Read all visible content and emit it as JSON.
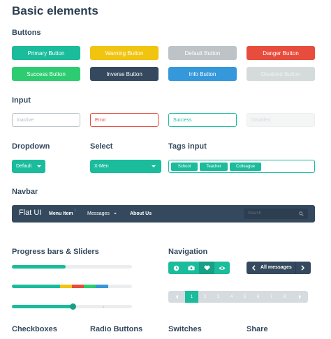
{
  "page_title": "Basic elements",
  "sections": {
    "buttons": "Buttons",
    "input": "Input",
    "dropdown": "Dropdown",
    "select": "Select",
    "tags_input": "Tags input",
    "navbar": "Navbar",
    "progress": "Progress bars & Sliders",
    "navigation": "Navigation",
    "checkboxes": "Checkboxes",
    "radio_buttons": "Radio Buttons",
    "switches": "Switches",
    "share": "Share"
  },
  "buttons": {
    "primary": "Primary Button",
    "warning": "Warning Button",
    "default": "Default Button",
    "danger": "Danger Button",
    "success": "Success Button",
    "inverse": "Inverse Button",
    "info": "Info Button",
    "disabled": "Disabled Button"
  },
  "inputs": {
    "inactive_placeholder": "Inactive",
    "error_placeholder": "Error",
    "success_placeholder": "Success",
    "disabled_placeholder": "Disabled"
  },
  "dropdown": {
    "label": "Default"
  },
  "select": {
    "selected": "X-Men"
  },
  "tags": [
    "School",
    "Teacher",
    "Colleague"
  ],
  "navbar": {
    "brand": "Flat UI",
    "menu_item": "Menu Item",
    "menu_item_badge": "1",
    "messages": "Messages",
    "about": "About Us",
    "search_placeholder": "Search"
  },
  "progress": {
    "bar1_percent": 45,
    "bar2_segments": [
      {
        "color": "#1abc9c",
        "percent": 40
      },
      {
        "color": "#f1c40f",
        "percent": 10
      },
      {
        "color": "#e74c3c",
        "percent": 10
      },
      {
        "color": "#2ecc71",
        "percent": 10
      },
      {
        "color": "#3498db",
        "percent": 10
      }
    ],
    "slider_percent": 51
  },
  "navigation": {
    "icons": [
      "clock-icon",
      "camera-icon",
      "heart-icon",
      "eye-icon"
    ],
    "all_messages": "All messages",
    "pages": [
      "1",
      "2",
      "3",
      "4",
      "5",
      "6",
      "7",
      "8"
    ],
    "active_page": "1"
  },
  "colors": {
    "turquoise": "#1abc9c",
    "midnight": "#34495e",
    "sunflower": "#f1c40f",
    "alizarin": "#e74c3c",
    "emerald": "#2ecc71",
    "peter_river": "#3498db",
    "silver": "#bdc3c7"
  }
}
